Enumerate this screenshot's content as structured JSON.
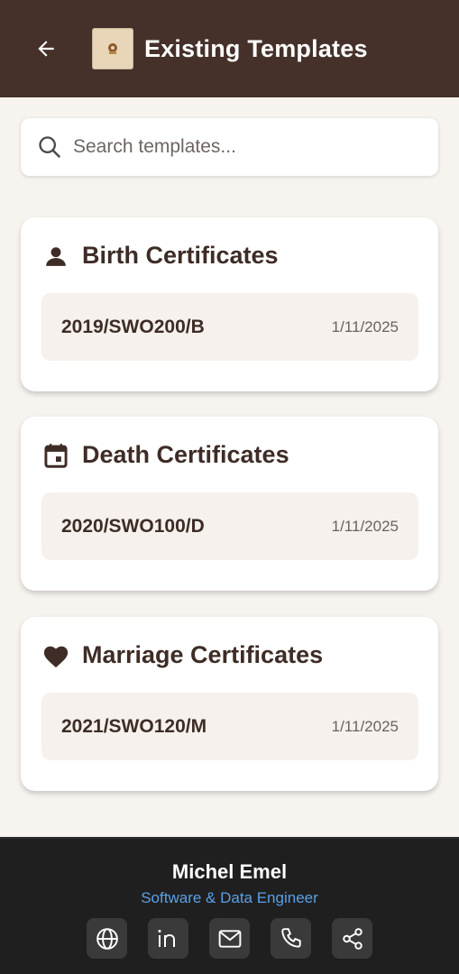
{
  "header": {
    "title": "Existing Templates",
    "back_icon": "arrow-left-icon",
    "logo_icon": "app-logo"
  },
  "search": {
    "placeholder": "Search templates...",
    "icon": "search-icon"
  },
  "sections": [
    {
      "title": "Birth Certificates",
      "icon": "person-icon",
      "items": [
        {
          "code": "2019/SWO200/B",
          "date": "1/11/2025"
        }
      ]
    },
    {
      "title": "Death Certificates",
      "icon": "calendar-icon",
      "items": [
        {
          "code": "2020/SWO100/D",
          "date": "1/11/2025"
        }
      ]
    },
    {
      "title": "Marriage Certificates",
      "icon": "heart-icon",
      "items": [
        {
          "code": "2021/SWO120/M",
          "date": "1/11/2025"
        }
      ]
    }
  ],
  "footer": {
    "name": "Michel Emel",
    "role": "Software & Data Engineer",
    "links": [
      "globe-icon",
      "linkedin-icon",
      "mail-icon",
      "phone-icon",
      "share-icon"
    ]
  },
  "colors": {
    "header_bg": "#45302a",
    "page_bg": "#f7f3ef",
    "footer_bg": "#1f1f1f",
    "role_text": "#5aa0e6",
    "text_dark": "#3e2c26"
  }
}
